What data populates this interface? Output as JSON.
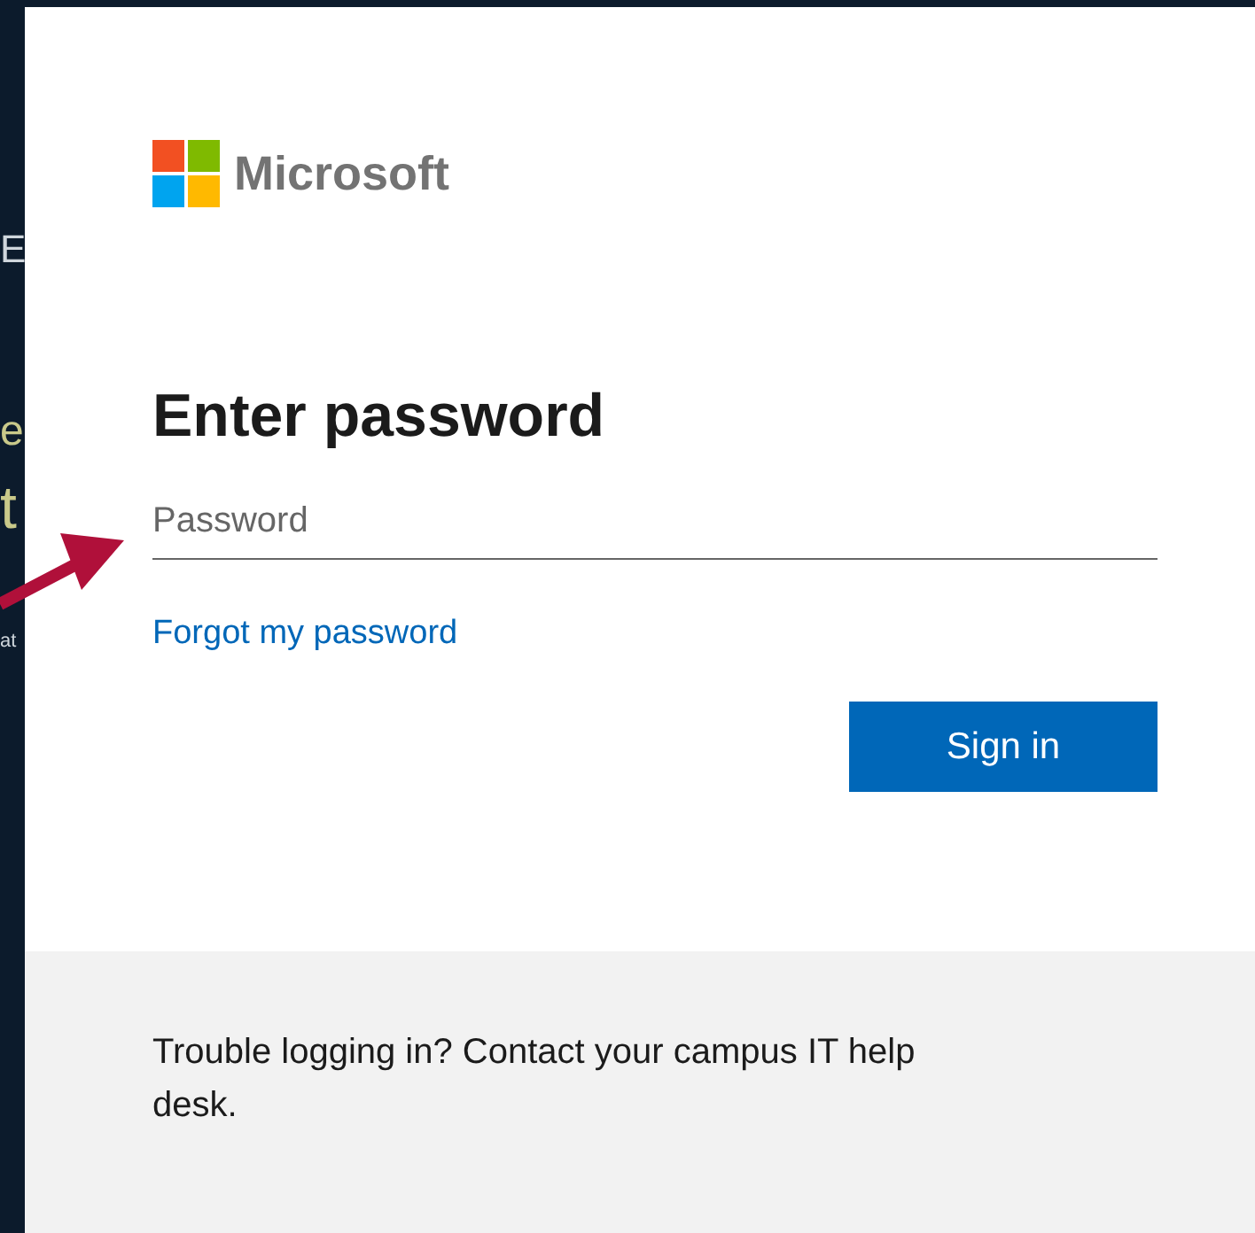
{
  "background_text": [
    "E",
    "e",
    "t",
    "at"
  ],
  "logo": {
    "text": "Microsoft"
  },
  "title": "Enter password",
  "password_field": {
    "placeholder": "Password"
  },
  "forgot_link": "Forgot my password",
  "sign_in_button": "Sign in",
  "footer": {
    "text": "Trouble logging in? Contact your campus IT help desk."
  }
}
